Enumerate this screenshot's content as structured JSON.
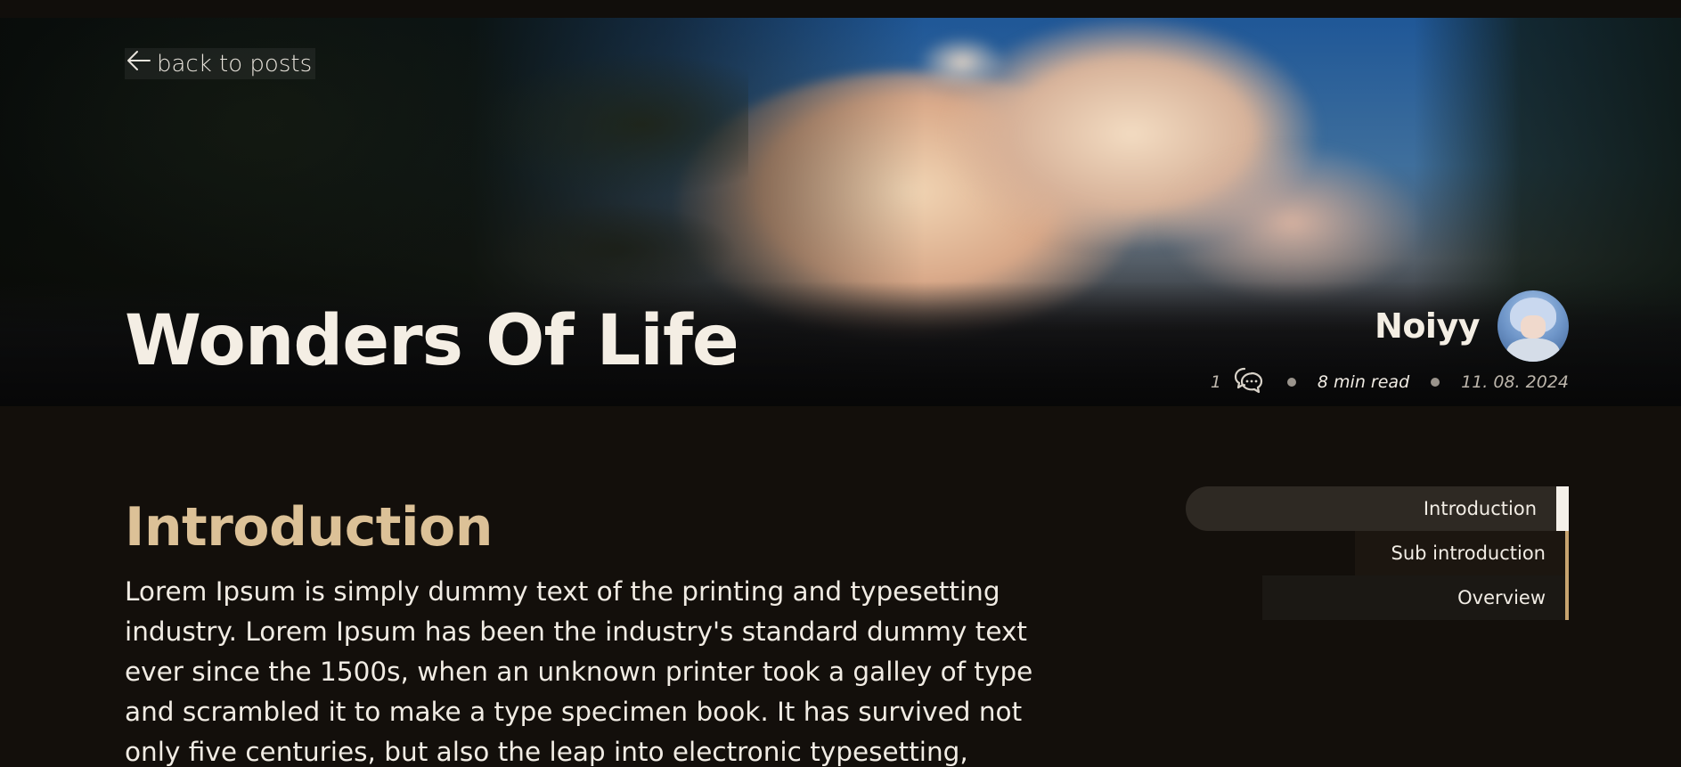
{
  "nav": {
    "back_label": "back to posts",
    "back_icon": "arrow-left-icon"
  },
  "post": {
    "title": "Wonders Of Life"
  },
  "author": {
    "name": "Noiyy"
  },
  "meta": {
    "comment_count": "1",
    "comment_icon": "comment-bubble-icon",
    "read_time": "8 min read",
    "date": "11. 08. 2024"
  },
  "content": {
    "heading": "Introduction",
    "body": "Lorem Ipsum is simply dummy text of the printing and typesetting industry. Lorem Ipsum has been the industry's standard dummy text ever since the 1500s, when an unknown printer took a galley of type and scrambled it to make a type specimen book. It has survived not only five centuries, but also the leap into electronic typesetting,"
  },
  "toc": {
    "items": [
      {
        "label": "Introduction"
      },
      {
        "label": "Sub introduction"
      },
      {
        "label": "Overview"
      }
    ]
  },
  "colors": {
    "background": "#130f0b",
    "heading_accent": "#dcc197",
    "toc_accent": "#c7a46f"
  }
}
